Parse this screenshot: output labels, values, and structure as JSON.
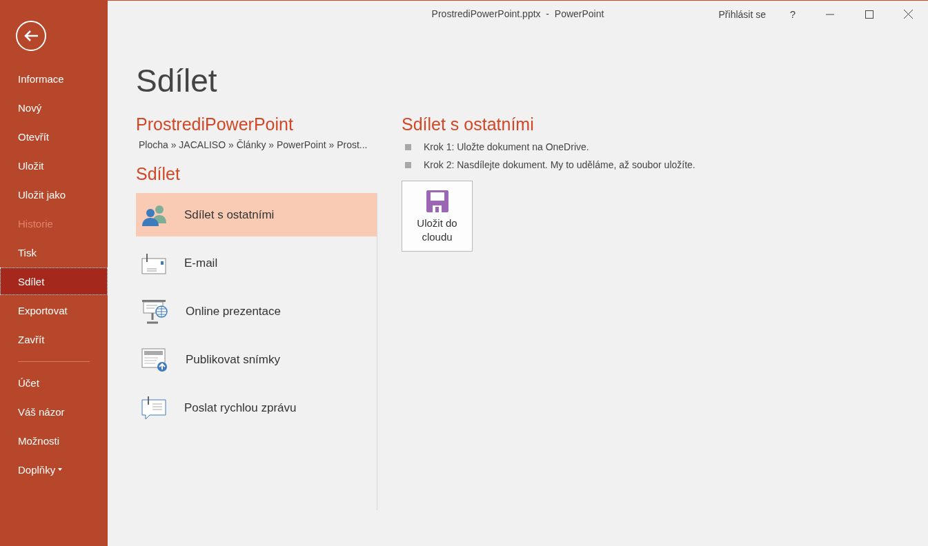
{
  "window": {
    "title": "ProstrediPowerPoint.pptx  -  PowerPoint",
    "sign_in": "Přihlásit se",
    "help": "?"
  },
  "sidebar": {
    "items_top": [
      {
        "label": "Informace",
        "selected": false,
        "disabled": false,
        "has_menu": false
      },
      {
        "label": "Nový",
        "selected": false,
        "disabled": false,
        "has_menu": false
      },
      {
        "label": "Otevřít",
        "selected": false,
        "disabled": false,
        "has_menu": false
      },
      {
        "label": "Uložit",
        "selected": false,
        "disabled": false,
        "has_menu": false
      },
      {
        "label": "Uložit jako",
        "selected": false,
        "disabled": false,
        "has_menu": false
      },
      {
        "label": "Historie",
        "selected": false,
        "disabled": true,
        "has_menu": false
      },
      {
        "label": "Tisk",
        "selected": false,
        "disabled": false,
        "has_menu": false
      },
      {
        "label": "Sdílet",
        "selected": true,
        "disabled": false,
        "has_menu": false
      },
      {
        "label": "Exportovat",
        "selected": false,
        "disabled": false,
        "has_menu": false
      },
      {
        "label": "Zavřít",
        "selected": false,
        "disabled": false,
        "has_menu": false
      }
    ],
    "items_bottom": [
      {
        "label": "Účet",
        "selected": false,
        "disabled": false,
        "has_menu": false
      },
      {
        "label": "Váš názor",
        "selected": false,
        "disabled": false,
        "has_menu": false
      },
      {
        "label": "Možnosti",
        "selected": false,
        "disabled": false,
        "has_menu": false
      },
      {
        "label": "Doplňky",
        "selected": false,
        "disabled": false,
        "has_menu": true
      }
    ]
  },
  "page_title": "Sdílet",
  "document": {
    "name": "ProstrediPowerPoint",
    "path": "Plocha » JACALISO » Články » PowerPoint » Prost..."
  },
  "share_heading": "Sdílet",
  "share_options": [
    {
      "kind": "people",
      "label": "Sdílet s ostatními",
      "selected": true
    },
    {
      "kind": "email",
      "label": "E-mail",
      "selected": false
    },
    {
      "kind": "present",
      "label": "Online prezentace",
      "selected": false
    },
    {
      "kind": "publish",
      "label": "Publikovat snímky",
      "selected": false
    },
    {
      "kind": "message",
      "label": "Poslat rychlou zprávu",
      "selected": false
    }
  ],
  "detail": {
    "heading": "Sdílet s ostatními",
    "steps": [
      "Krok 1: Uložte dokument na OneDrive.",
      "Krok 2: Nasdílejte dokument. My to uděláme, až soubor uložíte."
    ],
    "button": {
      "line_1": "Uložit do",
      "line_2": "cloudu"
    }
  }
}
